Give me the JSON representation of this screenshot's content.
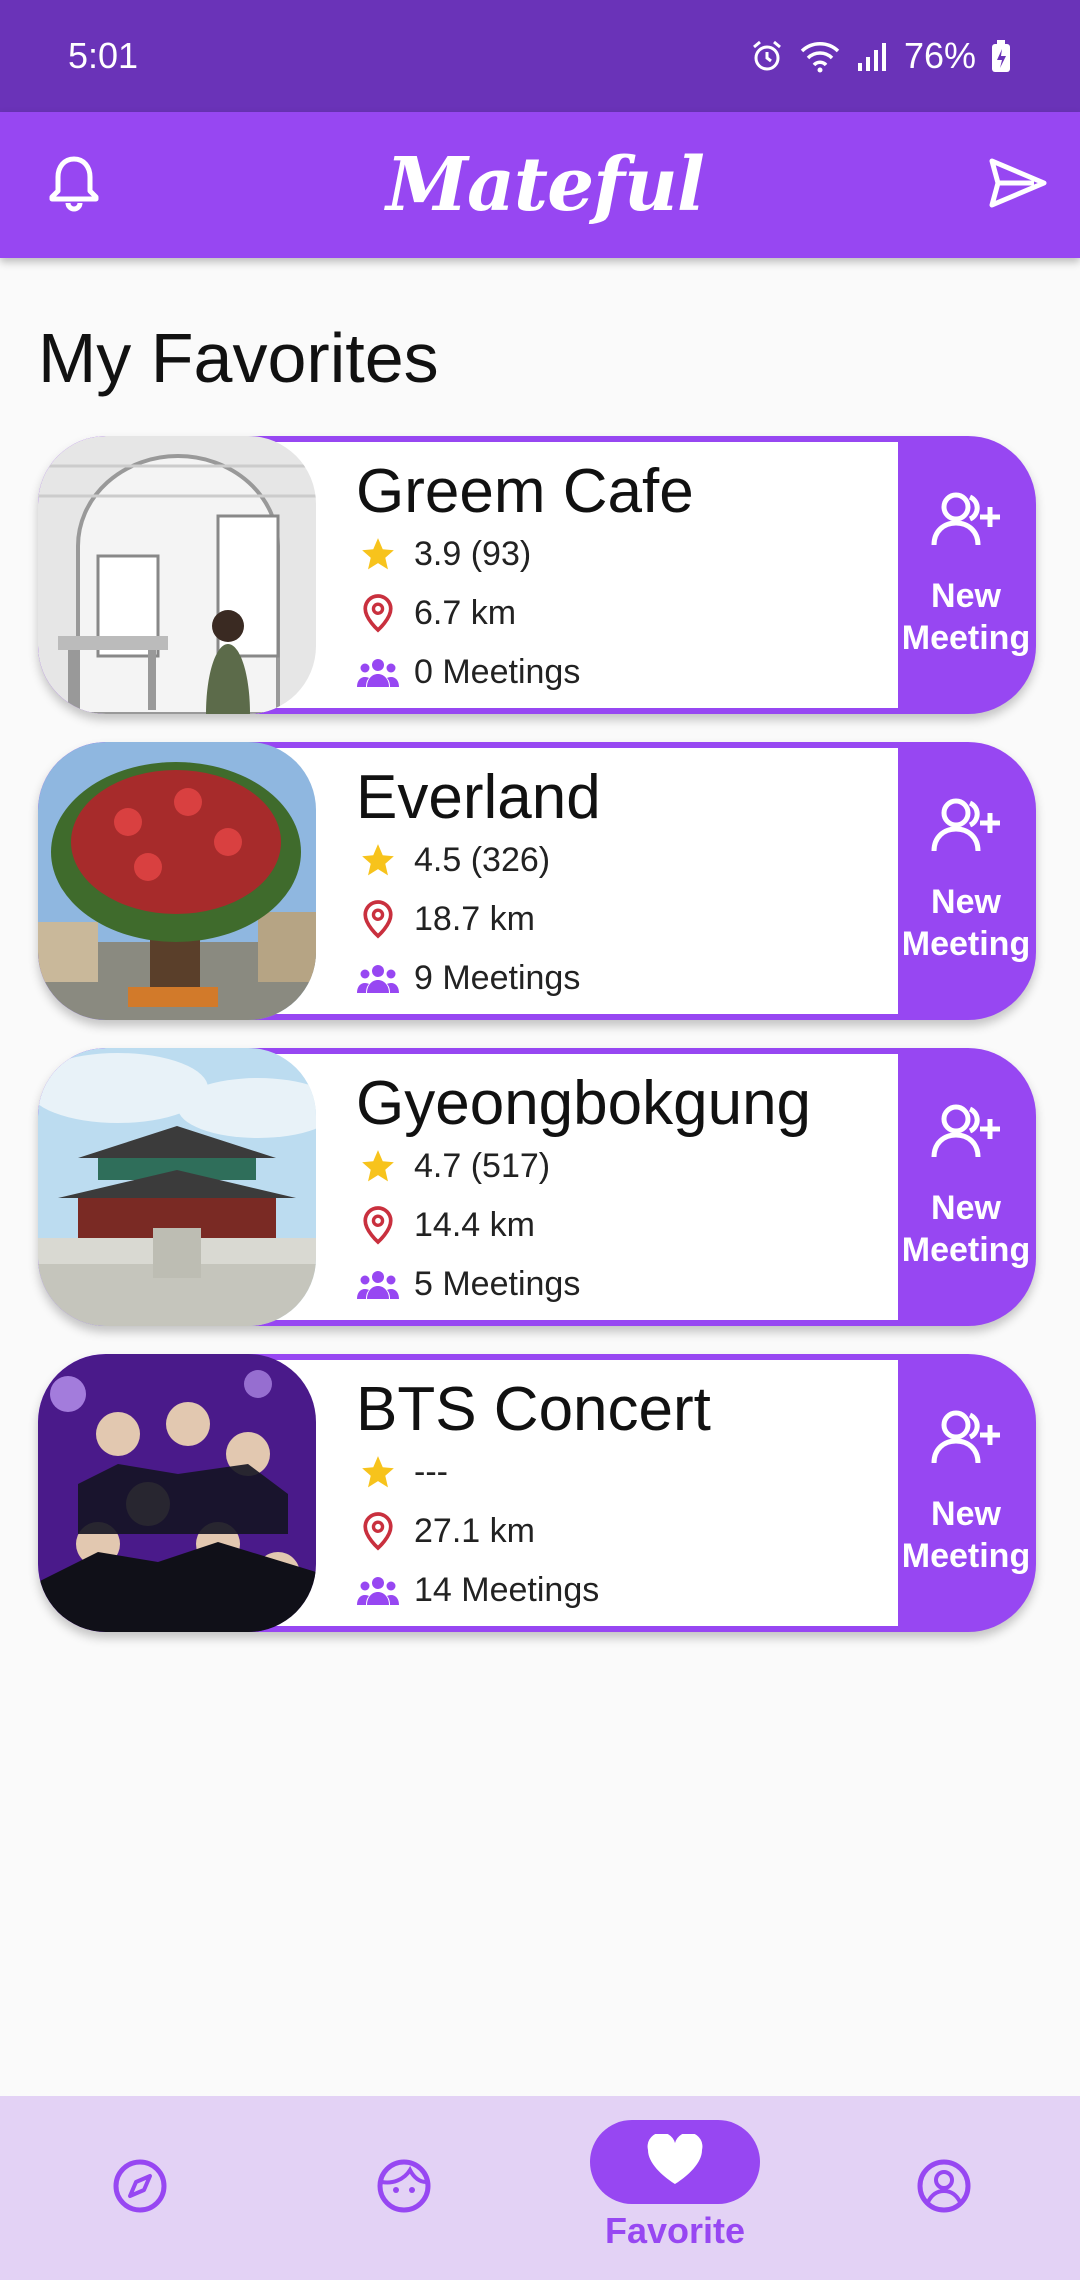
{
  "status_bar": {
    "time": "5:01",
    "battery": "76%",
    "icons": [
      "alarm-icon",
      "wifi-icon",
      "signal-icon",
      "battery-icon"
    ]
  },
  "app_bar": {
    "title": "Mateful",
    "left_icon": "bell-icon",
    "right_icon": "send-icon"
  },
  "page_title": "My Favorites",
  "favorites": [
    {
      "name": "Greem Cafe",
      "rating": "3.9 (93)",
      "distance": "6.7 km",
      "meetings": "0 Meetings",
      "photo": "cafe-photo",
      "button": {
        "line1": "New",
        "line2": "Meeting"
      }
    },
    {
      "name": "Everland",
      "rating": "4.5 (326)",
      "distance": "18.7 km",
      "meetings": "9 Meetings",
      "photo": "everland-photo",
      "button": {
        "line1": "New",
        "line2": "Meeting"
      }
    },
    {
      "name": "Gyeongbokgung",
      "rating": "4.7 (517)",
      "distance": "14.4 km",
      "meetings": "5 Meetings",
      "photo": "palace-photo",
      "button": {
        "line1": "New",
        "line2": "Meeting"
      }
    },
    {
      "name": "BTS Concert",
      "rating": "---",
      "distance": "27.1 km",
      "meetings": "14 Meetings",
      "photo": "concert-photo",
      "button": {
        "line1": "New",
        "line2": "Meeting"
      }
    }
  ],
  "bottom_nav": {
    "items": [
      {
        "icon": "compass-icon"
      },
      {
        "icon": "face-icon"
      },
      {
        "icon": "heart-icon",
        "label": "Favorite",
        "active": true
      },
      {
        "icon": "profile-icon"
      }
    ]
  },
  "colors": {
    "primary": "#9747f2",
    "status_bar": "#6a33b8",
    "star": "#f7c31c",
    "pin": "#c9303e",
    "nav_bg": "#e3d2f5"
  }
}
